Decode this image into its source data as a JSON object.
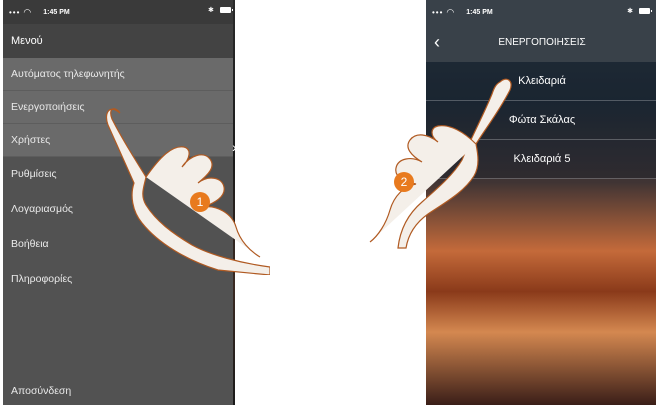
{
  "status_bar": {
    "signal": "•••",
    "time": "1:45 PM",
    "bluetooth": "✱"
  },
  "left_panel": {
    "menu_title": "Μενού",
    "items": [
      {
        "label": "Αυτόματος τηλεφωνητής"
      },
      {
        "label": "Ενεργοποιήσεις"
      },
      {
        "label": "Χρήστες"
      },
      {
        "label": "Ρυθμίσεις"
      },
      {
        "label": "Λογαριασμός"
      },
      {
        "label": "Βοήθεια"
      },
      {
        "label": "Πληροφορίες"
      }
    ],
    "logout": "Αποσύνδεση"
  },
  "right_panel": {
    "title": "ΕΝΕΡΓΟΠΟΙΗΣΕΙΣ",
    "items": [
      {
        "label": "Κλειδαριά"
      },
      {
        "label": "Φώτα Σκάλας"
      },
      {
        "label": "Κλειδαριά 5"
      }
    ]
  },
  "steps": {
    "step1": "1",
    "step2": "2"
  },
  "icons": [
    "wifi-icon",
    "battery-icon",
    "bluetooth-icon",
    "back-arrow-icon",
    "chevron-right-icon",
    "pointing-hand-icon"
  ],
  "colors": {
    "accent": "#e87a1e",
    "menu_bg": "#525252",
    "menu_highlight": "#6a6a6a",
    "header_bg": "#394149"
  }
}
